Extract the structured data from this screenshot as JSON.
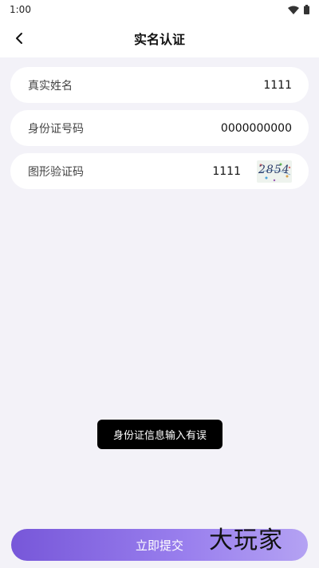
{
  "status_bar": {
    "time": "1:00"
  },
  "nav": {
    "title": "实名认证"
  },
  "form": {
    "real_name": {
      "label": "真实姓名",
      "value": "1111"
    },
    "id_number": {
      "label": "身份证号码",
      "value": "0000000000"
    },
    "captcha": {
      "label": "图形验证码",
      "value": "1111",
      "image_text": "2854"
    }
  },
  "toast": {
    "message": "身份证信息输入有误"
  },
  "submit": {
    "label": "立即提交"
  },
  "watermark": {
    "text": "大玩家"
  },
  "colors": {
    "accent_start": "#7757d9",
    "accent_end": "#b4a2f3",
    "background": "#f3f2f8"
  }
}
